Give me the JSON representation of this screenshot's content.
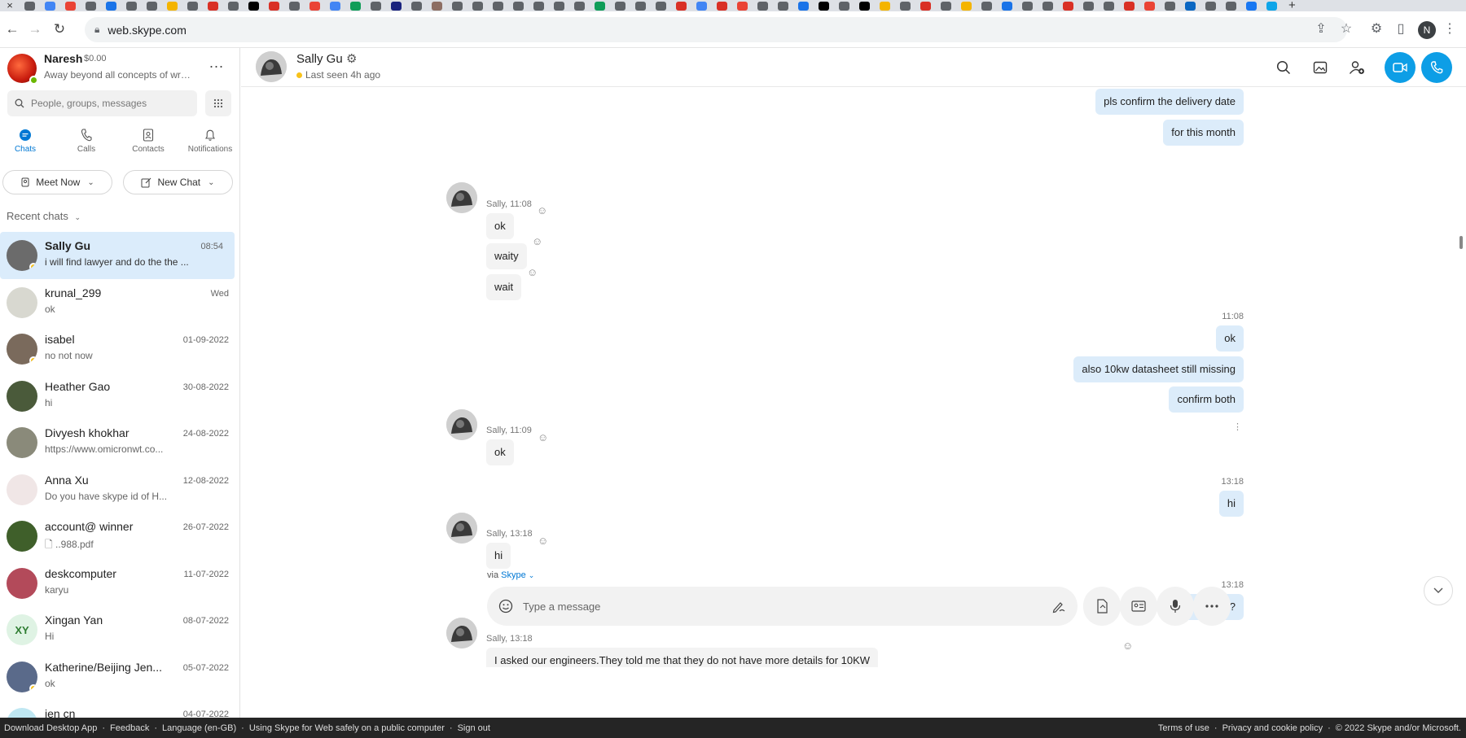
{
  "browser": {
    "tab_close": "×",
    "new_tab": "+",
    "url": "web.skype.com",
    "profile_initial": "N"
  },
  "me": {
    "name": "Naresh",
    "balance": "$0.00",
    "mood": "Away beyond all concepts of wrong...",
    "more": "..."
  },
  "search": {
    "placeholder": "People, groups, messages"
  },
  "nav": {
    "chats": "Chats",
    "calls": "Calls",
    "contacts": "Contacts",
    "notifications": "Notifications"
  },
  "actions": {
    "meet_now": "Meet Now",
    "new_chat": "New Chat"
  },
  "recent_chats_label": "Recent chats",
  "chats": [
    {
      "name": "Sally Gu",
      "preview": "i will find lawyer and do the the ...",
      "date": "08:54",
      "selected": true,
      "color": "#6b6b6b",
      "status": "away"
    },
    {
      "name": "krunal_299",
      "preview": "ok",
      "date": "Wed",
      "color": "#d8d8d0"
    },
    {
      "name": "isabel",
      "preview": "no not now",
      "date": "01-09-2022",
      "color": "#7a6a5c",
      "status": "away"
    },
    {
      "name": "Heather Gao",
      "preview": "hi",
      "date": "30-08-2022",
      "color": "#4a5a3a"
    },
    {
      "name": "Divyesh khokhar",
      "preview": "https://www.omicronwt.co...",
      "date": "24-08-2022",
      "color": "#8a8a7a"
    },
    {
      "name": "Anna Xu",
      "preview": "Do you have skype id of H...",
      "date": "12-08-2022",
      "color": "#f0e6e6"
    },
    {
      "name": "account@ winner",
      "preview": "..988.pdf",
      "date": "26-07-2022",
      "color": "#3f5f2a",
      "file": true
    },
    {
      "name": "deskcomputer",
      "preview": "karyu",
      "date": "11-07-2022",
      "color": "#b34a5a"
    },
    {
      "name": "Xingan  Yan",
      "preview": "Hi",
      "date": "08-07-2022",
      "initials": "XY",
      "color": "#dff3e4"
    },
    {
      "name": "Katherine/Beijing Jen...",
      "preview": "ok",
      "date": "05-07-2022",
      "color": "#5a6a8a",
      "status": "away"
    },
    {
      "name": "jen cn",
      "preview": "",
      "date": "04-07-2022",
      "color": "#bfe7f2"
    }
  ],
  "conversation": {
    "contact_name": "Sally Gu",
    "last_seen": "Last seen 4h ago",
    "messages_out_top": [
      "pls confirm the delivery date",
      "for this month"
    ],
    "group1": {
      "meta": "Sally, 11:08",
      "messages": [
        "ok",
        "waity",
        "wait"
      ]
    },
    "group2": {
      "time": "11:08",
      "messages": [
        "ok",
        "also 10kw datasheet still missing",
        "confirm both"
      ]
    },
    "group3": {
      "meta": "Sally, 11:09",
      "messages": [
        "ok"
      ]
    },
    "group4": {
      "time": "13:18",
      "messages": [
        "hi"
      ]
    },
    "group5": {
      "meta": "Sally, 13:18",
      "messages": [
        "hi"
      ]
    },
    "group6": {
      "time": "13:18",
      "messages": [
        "any update ?"
      ]
    },
    "group7": {
      "meta": "Sally, 13:18",
      "messages": [
        "I asked our engineers.They told me that they do not have more details for 10KW"
      ]
    }
  },
  "composer": {
    "via": "via",
    "via_brand": "Skype",
    "placeholder": "Type a message"
  },
  "footer": {
    "left": [
      "Download Desktop App",
      "Feedback",
      "Language (en-GB)",
      "Using Skype for Web safely on a public computer",
      "Sign out"
    ],
    "right": [
      "Terms of use",
      "Privacy and cookie policy",
      "© 2022 Skype and/or Microsoft."
    ]
  },
  "colors": {
    "accent": "#0078d4",
    "call_button": "#0d9ee6",
    "outgoing": "#dcecfa",
    "incoming": "#f3f3f3",
    "away": "#f8c21a",
    "online": "#6bb700"
  }
}
